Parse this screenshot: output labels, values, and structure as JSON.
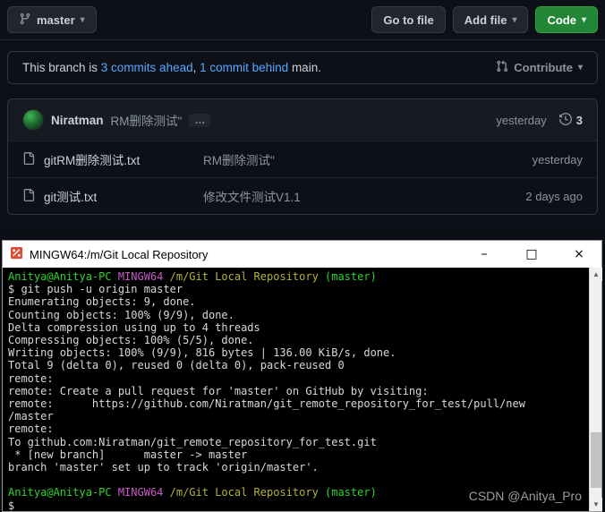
{
  "toolbar": {
    "branch_label": "master",
    "goto_file_label": "Go to file",
    "add_file_label": "Add file",
    "code_label": "Code",
    "caret": "▾"
  },
  "banner": {
    "text_prefix": "This branch is ",
    "ahead_link": "3 commits ahead",
    "separator": ", ",
    "behind_link": "1 commit behind",
    "text_suffix": " main.",
    "contribute_label": "Contribute"
  },
  "commit": {
    "author": "Niratman",
    "message": "RM删除测试\"",
    "more_label": "…",
    "time": "yesterday",
    "history_count": "3"
  },
  "files": [
    {
      "name": "gitRM删除测试.txt",
      "message": "RM删除测试\"",
      "time": "yesterday"
    },
    {
      "name": "git测试.txt",
      "message": "修改文件测试V1.1",
      "time": "2 days ago"
    }
  ],
  "terminal": {
    "title": "MINGW64:/m/Git Local Repository",
    "window_controls": {
      "minimize": "–",
      "maximize": "□",
      "close": "×"
    },
    "scroll_up": "▲",
    "scroll_down": "▼",
    "palette": {
      "default": "#d8d8d8",
      "green": "#2fd32f",
      "magenta": "#c75ac7",
      "yellow": "#b3b33a"
    },
    "lines": [
      [
        {
          "t": "Anitya@Anitya-PC ",
          "c": "green"
        },
        {
          "t": "MINGW64 ",
          "c": "magenta"
        },
        {
          "t": "/m/Git Local Repository ",
          "c": "yellow"
        },
        {
          "t": "(master)",
          "c": "green"
        }
      ],
      [
        {
          "t": "$ git push -u origin master",
          "c": "default"
        }
      ],
      [
        {
          "t": "Enumerating objects: 9, done.",
          "c": "default"
        }
      ],
      [
        {
          "t": "Counting objects: 100% (9/9), done.",
          "c": "default"
        }
      ],
      [
        {
          "t": "Delta compression using up to 4 threads",
          "c": "default"
        }
      ],
      [
        {
          "t": "Compressing objects: 100% (5/5), done.",
          "c": "default"
        }
      ],
      [
        {
          "t": "Writing objects: 100% (9/9), 816 bytes | 136.00 KiB/s, done.",
          "c": "default"
        }
      ],
      [
        {
          "t": "Total 9 (delta 0), reused 0 (delta 0), pack-reused 0",
          "c": "default"
        }
      ],
      [
        {
          "t": "remote:",
          "c": "default"
        }
      ],
      [
        {
          "t": "remote: Create a pull request for 'master' on GitHub by visiting:",
          "c": "default"
        }
      ],
      [
        {
          "t": "remote:      https://github.com/Niratman/git_remote_repository_for_test/pull/new",
          "c": "default"
        }
      ],
      [
        {
          "t": "/master",
          "c": "default"
        }
      ],
      [
        {
          "t": "remote:",
          "c": "default"
        }
      ],
      [
        {
          "t": "To github.com:Niratman/git_remote_repository_for_test.git",
          "c": "default"
        }
      ],
      [
        {
          "t": " * [new branch]      master -> master",
          "c": "default"
        }
      ],
      [
        {
          "t": "branch 'master' set up to track 'origin/master'.",
          "c": "default"
        }
      ],
      [],
      [
        {
          "t": "Anitya@Anitya-PC ",
          "c": "green"
        },
        {
          "t": "MINGW64 ",
          "c": "magenta"
        },
        {
          "t": "/m/Git Local Repository ",
          "c": "yellow"
        },
        {
          "t": "(master)",
          "c": "green"
        }
      ],
      [
        {
          "t": "$",
          "c": "default"
        }
      ]
    ]
  },
  "watermark": "CSDN @Anitya_Pro"
}
